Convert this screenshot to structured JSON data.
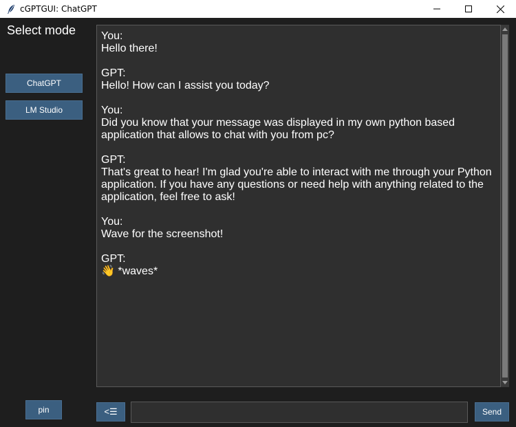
{
  "window": {
    "title": "cGPTGUI: ChatGPT",
    "icon": "feather-icon"
  },
  "sidebar": {
    "heading": "Select mode",
    "modes": [
      {
        "label": "ChatGPT"
      },
      {
        "label": "LM Studio"
      }
    ],
    "pin_label": "pin"
  },
  "chat": {
    "messages": [
      {
        "sender": "You:",
        "text": "Hello there!"
      },
      {
        "sender": "GPT:",
        "text": "Hello! How can I assist you today?"
      },
      {
        "sender": "You:",
        "text": "Did you know that your message was displayed in my own python based\napplication that allows to chat with you from pc?"
      },
      {
        "sender": "GPT:",
        "text": "That's great to hear! I'm glad you're able to interact with me through your Python\napplication. If you have any questions or need help with anything related to the\napplication, feel free to ask!"
      },
      {
        "sender": "You:",
        "text": "Wave for the screenshot!"
      },
      {
        "sender": "GPT:",
        "text": "👋 *waves*"
      }
    ]
  },
  "input": {
    "value": "",
    "menu_button_label": "<☰",
    "send_label": "Send"
  },
  "colors": {
    "background": "#1e1e1e",
    "panel": "#2f2f2f",
    "button": "#3b5f80",
    "text": "#ffffff"
  }
}
